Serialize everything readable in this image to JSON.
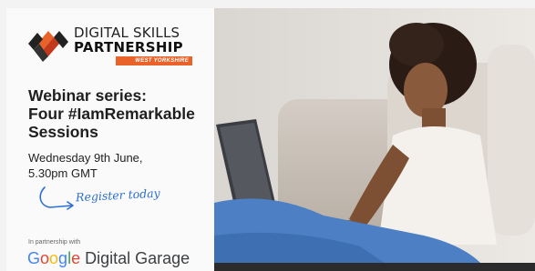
{
  "logo": {
    "line1": "DIGITAL SKILLS",
    "line2": "PARTNERSHIP",
    "region": "WEST YORKSHIRE"
  },
  "title_lines": [
    "Webinar series:",
    "Four #IamRemarkable",
    "Sessions"
  ],
  "date_lines": [
    "Wednesday 9th June,",
    "5.30pm GMT"
  ],
  "register": "Register today",
  "partner_text": "In partnership with",
  "google": {
    "letters": [
      "G",
      "o",
      "o",
      "g",
      "l",
      "e"
    ],
    "suffix": "Digital Garage"
  },
  "colors": {
    "accent_orange": "#e8622a",
    "link_blue": "#2c6fd1",
    "sofa": "#cfc7bf",
    "jeans": "#4c7fc4"
  },
  "photo": {
    "subject": "woman-with-laptop-on-sofa"
  }
}
